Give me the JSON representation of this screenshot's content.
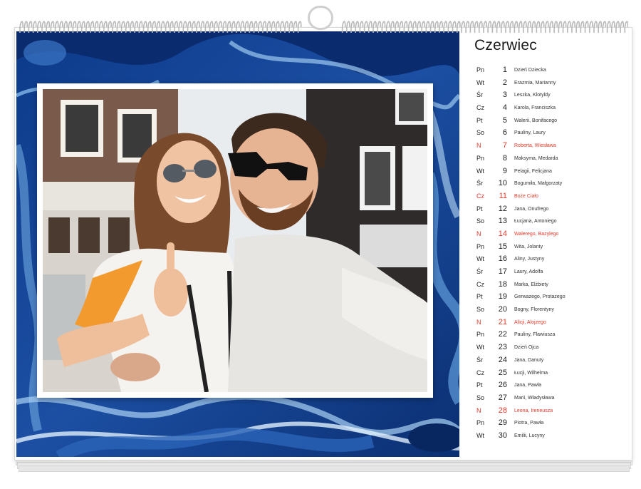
{
  "calendar": {
    "month": "Czerwiec",
    "days": [
      {
        "dow": "Pn",
        "day": "1",
        "names": "Dzień Dziecka",
        "holiday": false
      },
      {
        "dow": "Wt",
        "day": "2",
        "names": "Erazmia, Marianny",
        "holiday": false
      },
      {
        "dow": "Śr",
        "day": "3",
        "names": "Leszka, Klotyldy",
        "holiday": false
      },
      {
        "dow": "Cz",
        "day": "4",
        "names": "Karola, Franciszka",
        "holiday": false
      },
      {
        "dow": "Pt",
        "day": "5",
        "names": "Walerii, Bonifacego",
        "holiday": false
      },
      {
        "dow": "So",
        "day": "6",
        "names": "Pauliny, Laury",
        "holiday": false
      },
      {
        "dow": "N",
        "day": "7",
        "names": "Roberta, Wiesława",
        "holiday": true
      },
      {
        "dow": "Pn",
        "day": "8",
        "names": "Maksyma, Medarda",
        "holiday": false
      },
      {
        "dow": "Wt",
        "day": "9",
        "names": "Pelagii, Felicjana",
        "holiday": false
      },
      {
        "dow": "Śr",
        "day": "10",
        "names": "Bogumiła, Małgorzaty",
        "holiday": false
      },
      {
        "dow": "Cz",
        "day": "11",
        "names": "Boże Ciało",
        "holiday": true
      },
      {
        "dow": "Pt",
        "day": "12",
        "names": "Jana, Onufrego",
        "holiday": false
      },
      {
        "dow": "So",
        "day": "13",
        "names": "Łucjana, Antoniego",
        "holiday": false
      },
      {
        "dow": "N",
        "day": "14",
        "names": "Walerego, Bazylego",
        "holiday": true
      },
      {
        "dow": "Pn",
        "day": "15",
        "names": "Wita, Jolanty",
        "holiday": false
      },
      {
        "dow": "Wt",
        "day": "16",
        "names": "Aliny, Justyny",
        "holiday": false
      },
      {
        "dow": "Śr",
        "day": "17",
        "names": "Laury, Adolfa",
        "holiday": false
      },
      {
        "dow": "Cz",
        "day": "18",
        "names": "Marka, Elżbiety",
        "holiday": false
      },
      {
        "dow": "Pt",
        "day": "19",
        "names": "Gerwazego, Protazego",
        "holiday": false
      },
      {
        "dow": "So",
        "day": "20",
        "names": "Bogny, Florentyny",
        "holiday": false
      },
      {
        "dow": "N",
        "day": "21",
        "names": "Alicji, Alojzego",
        "holiday": true
      },
      {
        "dow": "Pn",
        "day": "22",
        "names": "Pauliny, Flawiusza",
        "holiday": false
      },
      {
        "dow": "Wt",
        "day": "23",
        "names": "Dzień Ojca",
        "holiday": false
      },
      {
        "dow": "Śr",
        "day": "24",
        "names": "Jana, Danuty",
        "holiday": false
      },
      {
        "dow": "Cz",
        "day": "25",
        "names": "Łucji, Wilhelma",
        "holiday": false
      },
      {
        "dow": "Pt",
        "day": "26",
        "names": "Jana, Pawła",
        "holiday": false
      },
      {
        "dow": "So",
        "day": "27",
        "names": "Marii, Władysława",
        "holiday": false
      },
      {
        "dow": "N",
        "day": "28",
        "names": "Leona, Ireneusza",
        "holiday": true
      },
      {
        "dow": "Pn",
        "day": "29",
        "names": "Piotra, Pawła",
        "holiday": false
      },
      {
        "dow": "Wt",
        "day": "30",
        "names": "Emilii, Lucyny",
        "holiday": false
      }
    ]
  },
  "colors": {
    "background_blue": "#123f8c",
    "holiday_red": "#e13a2b"
  },
  "icons": {
    "binding": "wire-binding-icon",
    "hanger": "hanger-hook-icon"
  }
}
